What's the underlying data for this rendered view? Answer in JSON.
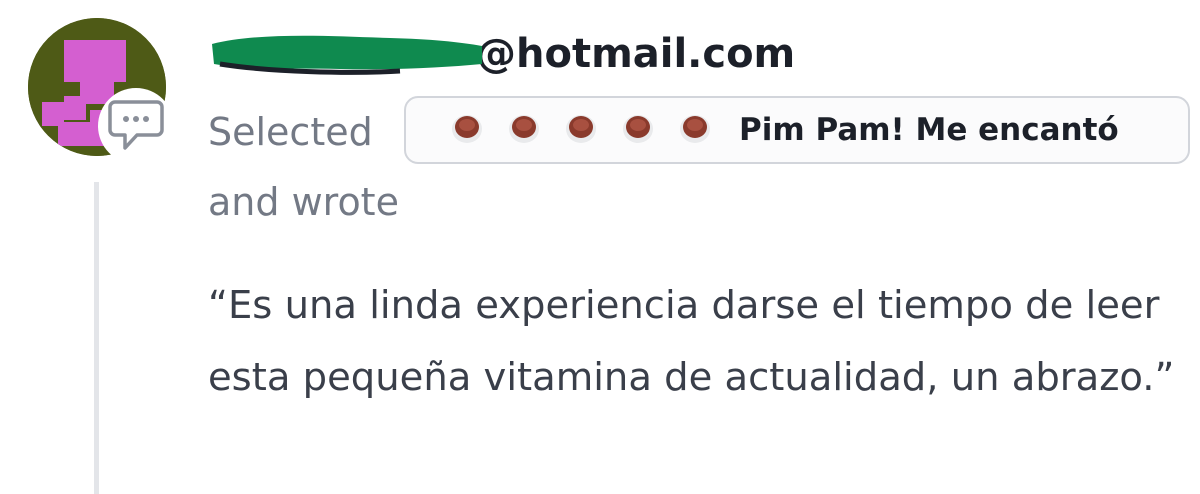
{
  "reviewer": {
    "email_domain": "@hotmail.com",
    "avatar_colors": {
      "background": "#4e5a16",
      "tiles": "#d45fd0"
    }
  },
  "review": {
    "selected_text": "Selected",
    "rating": {
      "value": 5,
      "max": 5,
      "icon": "coffee-cup-icon",
      "label": "Pim Pam! Me encantó"
    },
    "wrote_text": "and wrote",
    "quote": "“Es una linda experiencia darse el tiempo de leer esta pequeña vitamina de actualidad, un abrazo.”"
  },
  "icons": {
    "comment_badge": "speech-bubble-icon",
    "redaction": "green-marker-redaction"
  },
  "colors": {
    "text_primary": "#1c2029",
    "text_muted": "#737985",
    "pill_border": "#d2d5db",
    "redaction_marker": "#0f8a4f",
    "thread_line": "#e3e5e9"
  }
}
